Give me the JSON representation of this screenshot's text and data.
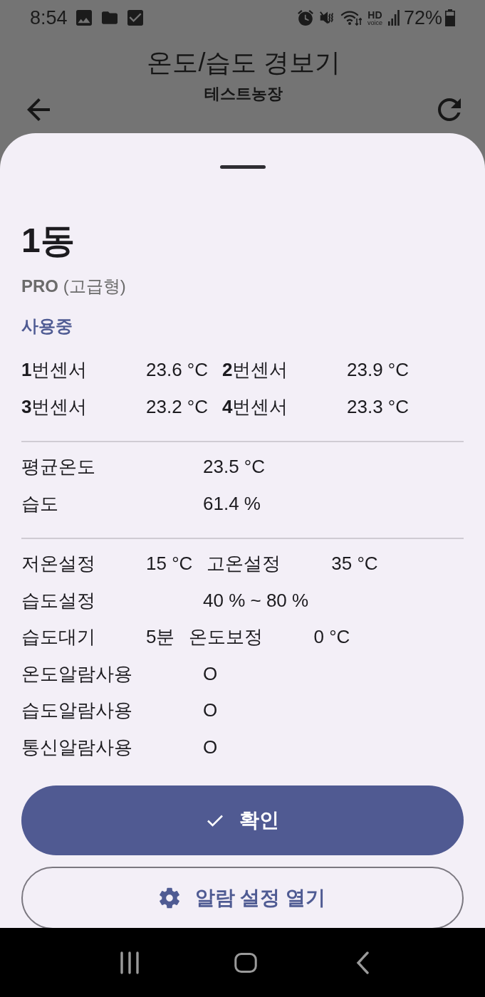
{
  "status_bar": {
    "time": "8:54",
    "hd_label": "HD",
    "voice_label": "voice",
    "battery": "72%"
  },
  "app_bar": {
    "title": "온도/습도 경보기",
    "subtitle": "테스트농장"
  },
  "sheet": {
    "title": "1동",
    "model": "**PRO** (고급형)",
    "status": "사용중",
    "sections": [
      {
        "rows": [
          {
            "pairs": [
              {
                "label": "**1**번센서",
                "value": "23.6 °C"
              },
              {
                "label": "**2**번센서",
                "value": "23.9 °C"
              }
            ]
          },
          {
            "pairs": [
              {
                "label": "**3**번센서",
                "value": "23.2 °C"
              },
              {
                "label": "**4**번센서",
                "value": "23.3 °C"
              }
            ]
          }
        ]
      },
      {
        "rows": [
          {
            "pairs": [
              {
                "label": "평균온도",
                "value": "23.5 °C"
              }
            ]
          },
          {
            "pairs": [
              {
                "label": "습도",
                "value": "61.4 %"
              }
            ]
          }
        ]
      },
      {
        "rows": [
          {
            "pairs": [
              {
                "label": "저온설정",
                "value": "15 °C"
              },
              {
                "label": "고온설정",
                "value": "35 °C"
              }
            ]
          },
          {
            "pairs": [
              {
                "label": "습도설정",
                "value": "40 % ~ 80 %"
              }
            ]
          },
          {
            "pairs": [
              {
                "label": "습도대기",
                "value": "5분"
              },
              {
                "label": "온도보정",
                "value": "0 °C"
              }
            ]
          },
          {
            "pairs": [
              {
                "label": "온도알람사용",
                "value": "O"
              }
            ]
          },
          {
            "pairs": [
              {
                "label": "습도알람사용",
                "value": "O"
              }
            ]
          },
          {
            "pairs": [
              {
                "label": "통신알람사용",
                "value": "O"
              }
            ]
          }
        ]
      }
    ],
    "buttons": [
      {
        "label": "확인",
        "kind": "filled"
      },
      {
        "label": "알람 설정 열기",
        "kind": "outlined"
      }
    ]
  }
}
